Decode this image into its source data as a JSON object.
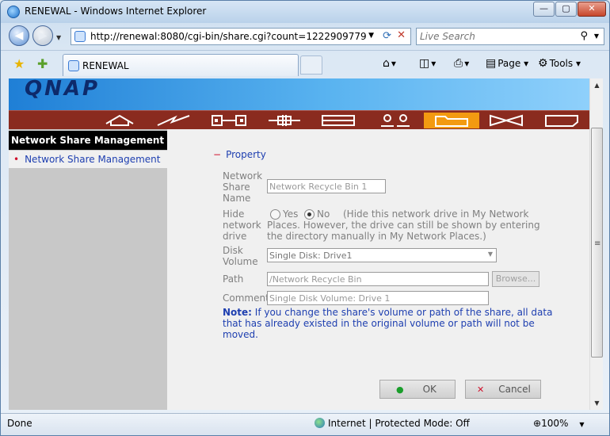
{
  "window": {
    "title": "RENEWAL - Windows Internet Explorer",
    "minimize": "—",
    "maximize": "▢",
    "close": "✕"
  },
  "address_bar": {
    "url": "http://renewal:8080/cgi-bin/share.cgi?count=1222909779",
    "search_placeholder": "Live Search"
  },
  "tab": {
    "label": "RENEWAL"
  },
  "toolbar": {
    "page_label": "Page",
    "tools_label": "Tools"
  },
  "app": {
    "logo": "QNAP",
    "menu_icons": [
      "home-icon",
      "lightning-icon",
      "plug-icon",
      "cross-connector-icon",
      "drive-icon",
      "users-icon",
      "folder-icon",
      "bowtie-icon",
      "tag-icon"
    ],
    "active_menu_index": 6,
    "accent_color": "#f39a11",
    "menubar_color": "#8a2b1f"
  },
  "sidebar": {
    "header": "Network Share Management",
    "items": [
      {
        "label": "Network Share Management"
      }
    ]
  },
  "form": {
    "section_title": "Property",
    "share_name_label": [
      "Network",
      "Share",
      "Name"
    ],
    "share_name_value": "Network Recycle Bin 1",
    "hide_label": [
      "Hide",
      "network",
      "drive"
    ],
    "yes_label": "Yes",
    "no_label": "No",
    "hide_selected": "No",
    "hide_hint": "(Hide this network drive in My Network Places. However, the drive can still be shown by entering the directory manually in My Network Places.)",
    "disk_volume_label": [
      "Disk",
      "Volume"
    ],
    "disk_volume_value": "Single Disk: Drive1",
    "path_label": "Path",
    "path_value": "/Network Recycle Bin",
    "browse_label": "Browse...",
    "comment_label": "Comment",
    "comment_value": "Single Disk Volume: Drive 1",
    "note_bold": "Note:",
    "note_text": " If you change the share's volume or path of the share, all data that has already existed in the original volume or path will not be moved.",
    "ok_label": "OK",
    "cancel_label": "Cancel"
  },
  "status_bar": {
    "left": "Done",
    "zone": "Internet | Protected Mode: Off",
    "zoom": "100%"
  }
}
